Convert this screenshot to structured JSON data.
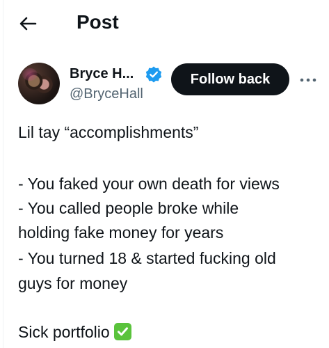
{
  "header": {
    "title": "Post",
    "back_icon": "arrow-left-icon"
  },
  "author": {
    "display_name": "Bryce H...",
    "handle": "@BryceHall",
    "verified_icon": "verified-badge-icon",
    "verified_color": "#1d9bf0"
  },
  "actions": {
    "follow_back_label": "Follow back",
    "more_icon": "more-horizontal-icon"
  },
  "post": {
    "lines": [
      "Lil tay “accomplishments”",
      "- You faked your own death for views",
      "- You called people broke while",
      "holding fake money for years",
      "- You turned 18 & started fucking old",
      "guys for money",
      "Sick portfolio"
    ],
    "emoji": "check-mark-button-emoji"
  },
  "colors": {
    "text": "#0f1419",
    "secondary": "#536471",
    "button_bg": "#0f1419",
    "emoji_green": "#5ac33c"
  }
}
